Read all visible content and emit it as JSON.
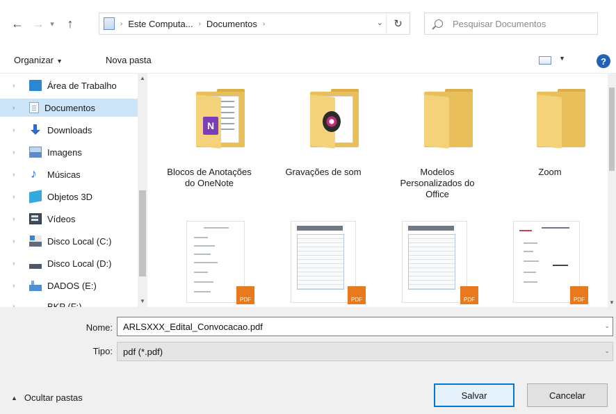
{
  "address_bar": {
    "crumbs": [
      "Este Computa...",
      "Documentos"
    ],
    "search_placeholder": "Pesquisar Documentos"
  },
  "toolbar": {
    "organize_label": "Organizar",
    "new_folder_label": "Nova pasta",
    "help_label": "?"
  },
  "nav_pane": {
    "items": [
      {
        "label": "Área de Trabalho",
        "icon": "desktop-icon",
        "selected": false
      },
      {
        "label": "Documentos",
        "icon": "documents-icon",
        "selected": true
      },
      {
        "label": "Downloads",
        "icon": "downloads-icon",
        "selected": false
      },
      {
        "label": "Imagens",
        "icon": "pictures-icon",
        "selected": false
      },
      {
        "label": "Músicas",
        "icon": "music-icon",
        "selected": false
      },
      {
        "label": "Objetos 3D",
        "icon": "objects-3d-icon",
        "selected": false
      },
      {
        "label": "Vídeos",
        "icon": "videos-icon",
        "selected": false
      },
      {
        "label": "Disco Local (C:)",
        "icon": "disk-c-icon",
        "selected": false
      },
      {
        "label": "Disco Local (D:)",
        "icon": "disk-d-icon",
        "selected": false
      },
      {
        "label": "DADOS (E:)",
        "icon": "drive-e-icon",
        "selected": false
      },
      {
        "label": "BKP (F:)",
        "icon": "drive-f-icon",
        "selected": false
      }
    ]
  },
  "content": {
    "folders": [
      {
        "label": "Blocos de Anotações do OneNote",
        "icon": "onenote-folder-icon"
      },
      {
        "label": "Gravações de som",
        "icon": "sound-recordings-folder-icon"
      },
      {
        "label": "Modelos Personalizados do Office",
        "icon": "folder-icon"
      },
      {
        "label": "Zoom",
        "icon": "folder-icon"
      }
    ],
    "pdf_badge_text": "PDF"
  },
  "save_form": {
    "name_label": "Nome:",
    "name_value": "ARLSXXX_Edital_Convocacao.pdf",
    "type_label": "Tipo:",
    "type_value": "pdf (*.pdf)",
    "hide_folders_label": "Ocultar pastas",
    "save_label": "Salvar",
    "cancel_label": "Cancelar"
  },
  "colors": {
    "selected_bg": "#cce4f7",
    "accent": "#0078d7",
    "pdf_badge": "#e8791c",
    "folder": "#e8bf5a"
  }
}
